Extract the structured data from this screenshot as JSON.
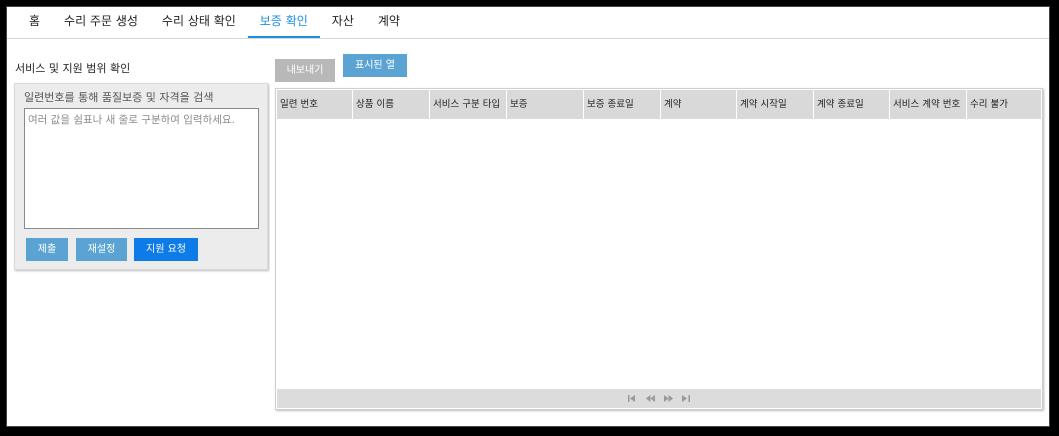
{
  "nav": {
    "tabs": [
      {
        "label": "홈"
      },
      {
        "label": "수리 주문 생성"
      },
      {
        "label": "수리 상태 확인"
      },
      {
        "label": "보증 확인",
        "active": true
      },
      {
        "label": "자산"
      },
      {
        "label": "계약"
      }
    ]
  },
  "left": {
    "title": "서비스 및 지원 범위 확인",
    "caption": "일련번호를 통해 품질보증 및 자격을 검색",
    "textarea_placeholder": "여러 값을 쉼표나 새 줄로 구분하여 입력하세요.",
    "buttons": {
      "submit": "제출",
      "reset": "재설정",
      "support": "지원 요청"
    }
  },
  "toolbar": {
    "export": "내보내기",
    "columns": "표시된 열"
  },
  "grid": {
    "columns": [
      "일련 번호",
      "상품 이름",
      "서비스 구분 타입",
      "보증",
      "보증 종료일",
      "계약",
      "계약 시작일",
      "계약 종료일",
      "서비스 계약 번호",
      "수리 불가"
    ]
  },
  "colors": {
    "accent": "#1b8fe0",
    "button": "#5aa3d3",
    "primary": "#0d7be8",
    "disabled": "#b8b8b8"
  }
}
